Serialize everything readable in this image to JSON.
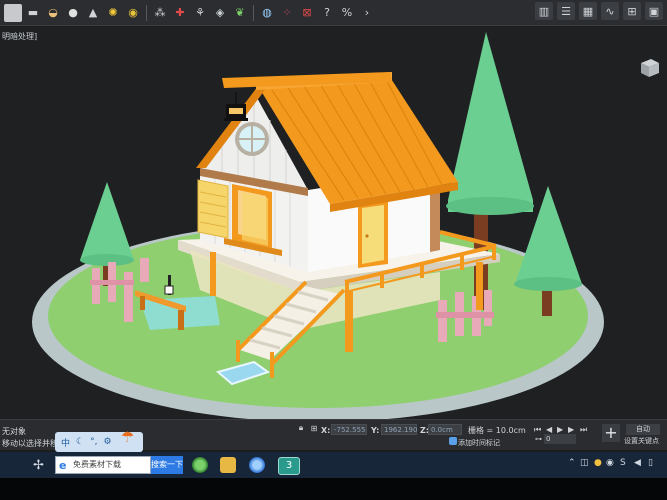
{
  "viewport": {
    "label": "明暗处理]"
  },
  "status": {
    "line1": "无对象",
    "line2": "移动以选择并移动"
  },
  "coords": {
    "x_label": "X:",
    "x_value": "-752.555",
    "y_label": "Y:",
    "y_value": "1962.190",
    "z_label": "Z:",
    "z_value": "0.0cm"
  },
  "grid": {
    "text": "栅格 = 10.0cm"
  },
  "timeline": {
    "add_tag": "添加时间标记",
    "frame": "0",
    "auto": "自动",
    "set_key": "设置关键点"
  },
  "ime": {
    "lang": "中"
  },
  "taskbar": {
    "search_text": "免费素材下载",
    "search_button": "搜索一下"
  },
  "colors": {
    "roof": "#f39a1e",
    "wall": "#f2f2f0",
    "grass": "#8ccf6e",
    "tree": "#6bcf95",
    "fence": "#e7a7b6"
  }
}
